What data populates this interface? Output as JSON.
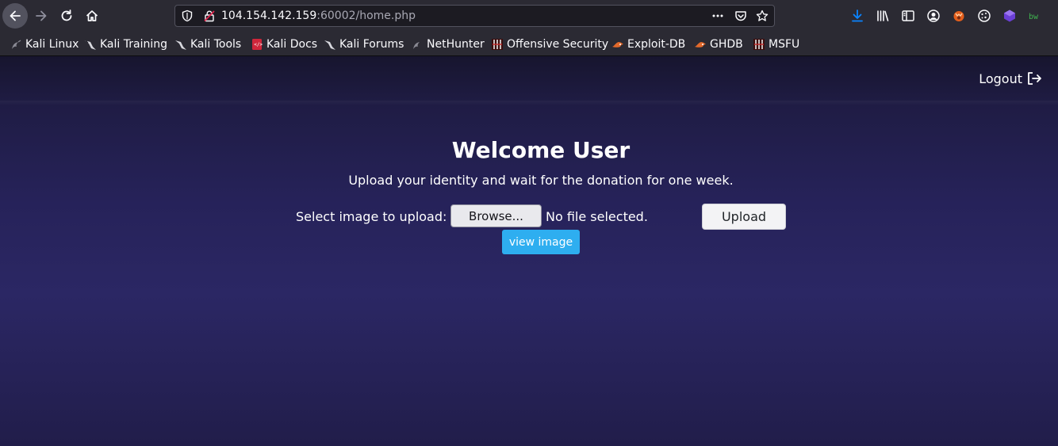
{
  "browser": {
    "url_host": "104.154.142.159",
    "url_rest": ":60002/home.php",
    "icons": [
      "back-icon",
      "forward-icon",
      "reload-icon",
      "home-icon",
      "tracking-shield-icon",
      "insecure-lock-icon",
      "page-actions-icon",
      "pocket-icon",
      "bookmark-star-icon",
      "downloads-icon",
      "library-icon",
      "sidebar-icon",
      "account-icon",
      "extension-icons"
    ],
    "accent_download": "#0a84ff"
  },
  "bookmarks": [
    {
      "label": "Kali Linux",
      "icon": "kali-dragon-icon"
    },
    {
      "label": "Kali Training",
      "icon": "kali-icon"
    },
    {
      "label": "Kali Tools",
      "icon": "kali-icon"
    },
    {
      "label": "Kali Docs",
      "icon": "kali-docs-icon"
    },
    {
      "label": "Kali Forums",
      "icon": "kali-icon"
    },
    {
      "label": "NetHunter",
      "icon": "kali-dragon-icon"
    },
    {
      "label": "Offensive Security",
      "icon": "offsec-icon"
    },
    {
      "label": "Exploit-DB",
      "icon": "exploitdb-icon"
    },
    {
      "label": "GHDB",
      "icon": "exploitdb-icon"
    },
    {
      "label": "MSFU",
      "icon": "offsec-icon"
    }
  ],
  "page": {
    "logout_label": "Logout",
    "title": "Welcome User",
    "subtitle": "Upload your identity and wait for the donation for one week.",
    "select_label": "Select image to upload:",
    "browse_label": "Browse...",
    "file_status": "No file selected.",
    "upload_label": "Upload",
    "view_label": "view image",
    "view_color": "#2eaef0"
  }
}
